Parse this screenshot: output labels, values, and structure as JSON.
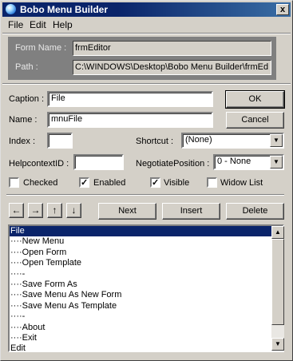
{
  "window": {
    "title": "Bobo Menu Builder",
    "close_glyph": "x"
  },
  "menubar": {
    "items": [
      "File",
      "Edit",
      "Help"
    ]
  },
  "form_info": {
    "form_name_label": "Form Name :",
    "form_name_value": "frmEditor",
    "path_label": "Path :",
    "path_value": "C:\\WINDOWS\\Desktop\\Bobo Menu Builder\\frmEd"
  },
  "fields": {
    "caption_label": "Caption :",
    "caption_value": "File",
    "name_label": "Name :",
    "name_value": "mnuFile",
    "index_label": "Index :",
    "index_value": "",
    "shortcut_label": "Shortcut :",
    "shortcut_value": "(None)",
    "helpcontext_label": "HelpcontextID :",
    "helpcontext_value": "",
    "negotiate_label": "NegotiatePosition :",
    "negotiate_value": "0 - None"
  },
  "buttons": {
    "ok": "OK",
    "cancel": "Cancel",
    "next": "Next",
    "insert": "Insert",
    "delete": "Delete"
  },
  "checkboxes": [
    {
      "label": "Checked",
      "checked": false
    },
    {
      "label": "Enabled",
      "checked": true
    },
    {
      "label": "Visible",
      "checked": true
    },
    {
      "label": "Widow List",
      "checked": false
    }
  ],
  "arrow_buttons": [
    "←",
    "→",
    "↑",
    "↓"
  ],
  "menu_list": [
    "File",
    "····New Menu",
    "····Open Form",
    "····Open Template",
    "····-",
    "····Save Form As",
    "····Save Menu As New Form",
    "····Save Menu As Template",
    "····-",
    "····About",
    "····Exit",
    "Edit"
  ],
  "selected_index": 0,
  "colors": {
    "selection": "#0a246a",
    "face": "#d4d0c8",
    "title_gradient_start": "#0a246a",
    "title_gradient_end": "#3a6ea5"
  }
}
